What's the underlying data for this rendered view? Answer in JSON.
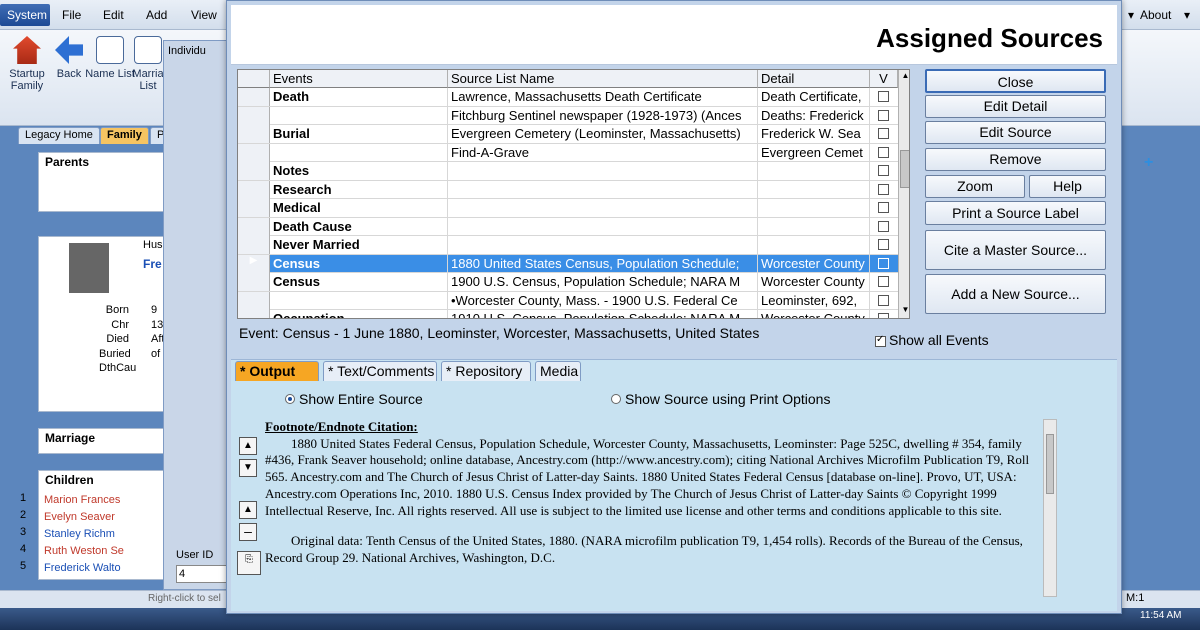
{
  "app": {
    "menu": [
      "System",
      "File",
      "Edit",
      "Add",
      "View"
    ],
    "menu_right": [
      "About"
    ],
    "ribbon": [
      {
        "label": "Startup Family"
      },
      {
        "label": "Back"
      },
      {
        "label": "Name List"
      },
      {
        "label": "Marria List"
      }
    ],
    "tabs": [
      "Legacy Home",
      "Family",
      "P"
    ],
    "sections": {
      "parents": "Parents",
      "marriage": "Marriage",
      "children": "Children"
    },
    "person": {
      "husband_label": "Hus",
      "name_fragment": "Fre",
      "facts": [
        "Born",
        "Chr",
        "Died",
        "Buried",
        "DthCau"
      ],
      "fact_values": [
        "9",
        "",
        "13",
        "Afte",
        "of"
      ]
    },
    "children": [
      {
        "num": "1",
        "name": "Marion Frances",
        "color": "#c0392b"
      },
      {
        "num": "2",
        "name": "Evelyn Seaver",
        "color": "#c0392b"
      },
      {
        "num": "3",
        "name": "Stanley Richm",
        "color": "#1a4fb5"
      },
      {
        "num": "4",
        "name": "Ruth Weston Se",
        "color": "#c0392b"
      },
      {
        "num": "5",
        "name": "Frederick Walto",
        "color": "#1a4fb5"
      }
    ],
    "individual_window_title": "Individu",
    "user_id_label": "User ID",
    "user_id_value": "4",
    "status_right": "M:1",
    "status_hint": "Right-click to sel",
    "clock": "11:54 AM"
  },
  "dialog": {
    "title": "Assigned Sources",
    "columns": [
      "Events",
      "Source List Name",
      "Detail",
      "V"
    ],
    "rows": [
      {
        "event": "Death",
        "source": "Lawrence, Massachusetts Death Certificate",
        "detail": "Death Certificate,",
        "selected": false
      },
      {
        "event": "",
        "source": "Fitchburg Sentinel newspaper (1928-1973) (Ances",
        "detail": "Deaths: Frederick",
        "selected": false
      },
      {
        "event": "Burial",
        "source": "Evergreen Cemetery (Leominster, Massachusetts)",
        "detail": "Frederick W. Sea",
        "selected": false
      },
      {
        "event": "",
        "source": "Find-A-Grave",
        "detail": "Evergreen Cemet",
        "selected": false
      },
      {
        "event": "Notes",
        "source": "",
        "detail": "",
        "selected": false
      },
      {
        "event": "Research",
        "source": "",
        "detail": "",
        "selected": false
      },
      {
        "event": "Medical",
        "source": "",
        "detail": "",
        "selected": false
      },
      {
        "event": "Death Cause",
        "source": "",
        "detail": "",
        "selected": false
      },
      {
        "event": "Never Married",
        "source": "",
        "detail": "",
        "selected": false
      },
      {
        "event": "Census",
        "source": "1880 United States Census, Population Schedule;",
        "detail": "Worcester County",
        "selected": true
      },
      {
        "event": "Census",
        "source": "1900 U.S. Census, Population Schedule; NARA M",
        "detail": "Worcester County",
        "selected": false
      },
      {
        "event": "",
        "source": "•Worcester County, Mass. - 1900 U.S. Federal Ce",
        "detail": "Leominster, 692,",
        "selected": false
      },
      {
        "event": "Occupation",
        "source": "1910 U.S. Census, Population Schedule; NARA M",
        "detail": "Worcester County",
        "selected": false
      }
    ],
    "buttons": {
      "close": "Close",
      "edit_detail": "Edit Detail",
      "edit_source": "Edit Source",
      "remove": "Remove",
      "zoom": "Zoom",
      "help": "Help",
      "print_label": "Print a Source Label",
      "cite_master": "Cite a Master Source...",
      "add_new": "Add a New Source..."
    },
    "event_line": "Event: Census - 1 June 1880, Leominster, Worcester, Massachusetts, United States",
    "show_all_events": "Show all Events",
    "show_all_checked": true,
    "tabs": [
      "* Output",
      "* Text/Comments",
      "* Repository",
      "Media"
    ],
    "active_tab": "* Output",
    "radio_entire": "Show Entire Source",
    "radio_print": "Show Source using Print Options",
    "citation_heading": "Footnote/Endnote Citation:",
    "citation_para1": "1880 United States Federal Census, Population Schedule, Worcester County, Massachusetts, Leominster: Page 525C, dwelling # 354, family #436, Frank Seaver household; online database, Ancestry.com (http://www.ancestry.com); citing National Archives Microfilm Publication T9, Roll 565. Ancestry.com and The Church of Jesus Christ of Latter-day Saints. 1880 United States Federal Census [database on-line]. Provo, UT, USA: Ancestry.com Operations Inc, 2010. 1880 U.S. Census Index provided by The Church of Jesus Christ of Latter-day Saints © Copyright 1999 Intellectual Reserve, Inc. All rights reserved. All use is subject to the limited use license and other terms and conditions applicable to this site.",
    "citation_para2": "Original data: Tenth Census of the United States, 1880. (NARA microfilm publication T9, 1,454 rolls). Records of the Bureau of the Census, Record Group 29. National Archives, Washington, D.C."
  },
  "colors": {
    "accent": "#3a8ee6",
    "active_tab": "#f6a623",
    "panel_bg": "#c8e2f1"
  }
}
